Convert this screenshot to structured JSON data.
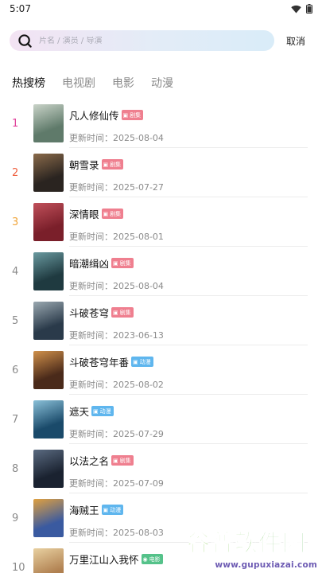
{
  "status": {
    "time": "5:07"
  },
  "search": {
    "placeholder": "片名 / 演员 / 导演",
    "cancel_label": "取消"
  },
  "tabs": [
    {
      "label": "热搜榜",
      "active": true
    },
    {
      "label": "电视剧",
      "active": false
    },
    {
      "label": "电影",
      "active": false
    },
    {
      "label": "动漫",
      "active": false
    }
  ],
  "update_prefix": "更新时间：",
  "items": [
    {
      "rank": "1",
      "title": "凡人修仙传",
      "tag": "剧集",
      "tag_color": "#ef7f8f",
      "date": "2025-08-04",
      "poster": [
        "#5f7a6a",
        "#c9d3c8"
      ]
    },
    {
      "rank": "2",
      "title": "朝雪录",
      "tag": "剧集",
      "tag_color": "#ef7f8f",
      "date": "2025-07-27",
      "poster": [
        "#2a2420",
        "#8a6a4a"
      ]
    },
    {
      "rank": "3",
      "title": "深情眼",
      "tag": "剧集",
      "tag_color": "#ef7f8f",
      "date": "2025-08-01",
      "poster": [
        "#7a1f2a",
        "#c0505a"
      ]
    },
    {
      "rank": "4",
      "title": "暗潮缉凶",
      "tag": "剧集",
      "tag_color": "#ef7f8f",
      "date": "2025-08-04",
      "poster": [
        "#1f3a40",
        "#6a9aa0"
      ]
    },
    {
      "rank": "5",
      "title": "斗破苍穹",
      "tag": "剧集",
      "tag_color": "#ef7f8f",
      "date": "2023-06-13",
      "poster": [
        "#2a3a4a",
        "#9aa8b0"
      ]
    },
    {
      "rank": "6",
      "title": "斗破苍穹年番",
      "tag": "动漫",
      "tag_color": "#5fb6ee",
      "date": "2025-08-02",
      "poster": [
        "#4a2a1a",
        "#d0904a"
      ]
    },
    {
      "rank": "7",
      "title": "遮天",
      "tag": "动漫",
      "tag_color": "#5fb6ee",
      "date": "2025-07-29",
      "poster": [
        "#1a4a6a",
        "#8ac0d8"
      ]
    },
    {
      "rank": "8",
      "title": "以法之名",
      "tag": "剧集",
      "tag_color": "#ef7f8f",
      "date": "2025-07-09",
      "poster": [
        "#1a2230",
        "#5a6a80"
      ]
    },
    {
      "rank": "9",
      "title": "海贼王",
      "tag": "动漫",
      "tag_color": "#5fb6ee",
      "date": "2025-08-03",
      "poster": [
        "#3a5aa0",
        "#e0a040"
      ]
    },
    {
      "rank": "10",
      "title": "万里江山入我怀",
      "tag": "电影",
      "tag_color": "#55c28a",
      "date": "",
      "poster": [
        "#b08050",
        "#e8d0a0"
      ]
    }
  ],
  "watermark": {
    "name": "谷普软件园",
    "url": "www.gupuxiazai.com"
  },
  "colors": {
    "rank1": "#e0409a",
    "rank2": "#ef5f3e",
    "rank3": "#f0a53a",
    "accent_search": "#e3ecf7"
  }
}
